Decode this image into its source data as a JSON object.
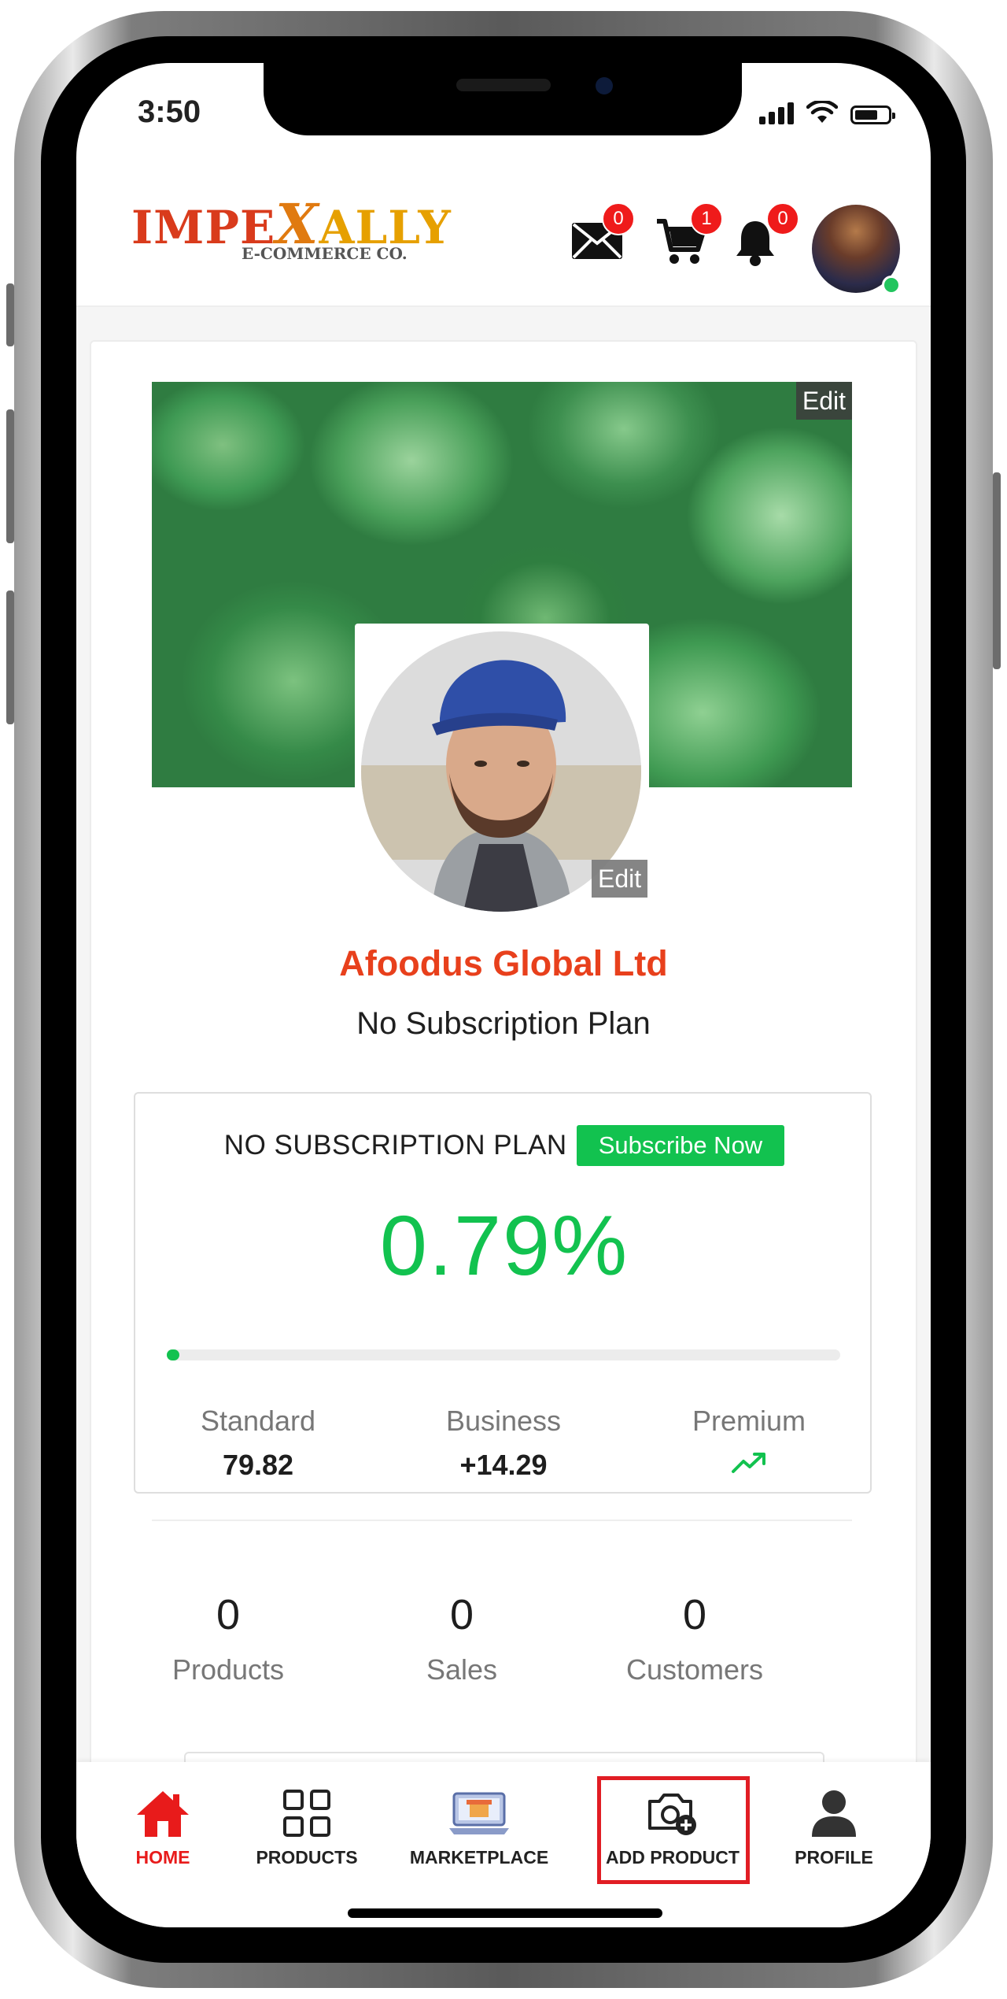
{
  "status_bar": {
    "time": "3:50"
  },
  "header": {
    "logo": {
      "main_left": "IMPE",
      "main_x": "X",
      "main_right": "ALLY",
      "sub": "E-COMMERCE CO."
    },
    "mail_badge": "0",
    "cart_badge": "1",
    "notification_badge": "0"
  },
  "cover": {
    "edit_label": "Edit"
  },
  "profile": {
    "edit_label": "Edit",
    "company_name": "Afoodus Global Ltd",
    "plan_text": "No Subscription Plan"
  },
  "subscription": {
    "label": "NO SUBSCRIPTION PLAN",
    "button": "Subscribe Now",
    "percent": "0.79%",
    "progress_fraction": 0.0079,
    "tiers": [
      {
        "name": "Standard",
        "value": "79.82"
      },
      {
        "name": "Business",
        "value": "+14.29"
      },
      {
        "name": "Premium",
        "value": ""
      }
    ]
  },
  "stats": [
    {
      "value": "0",
      "label": "Products"
    },
    {
      "value": "0",
      "label": "Sales"
    },
    {
      "value": "0",
      "label": "Customers"
    }
  ],
  "bottom_nav": [
    {
      "label": "HOME",
      "icon": "home-icon",
      "active": true
    },
    {
      "label": "PRODUCTS",
      "icon": "grid-icon",
      "active": false
    },
    {
      "label": "MARKETPLACE",
      "icon": "marketplace-icon",
      "active": false
    },
    {
      "label": "ADD PRODUCT",
      "icon": "camera-add-icon",
      "active": false
    },
    {
      "label": "PROFILE",
      "icon": "person-icon",
      "active": false
    }
  ],
  "colors": {
    "accent_green": "#12c24f",
    "brand_red": "#e8401c",
    "active_nav_red": "#e81b1b",
    "badge_red": "#ef1b1b",
    "highlight_red": "#e11d24"
  }
}
